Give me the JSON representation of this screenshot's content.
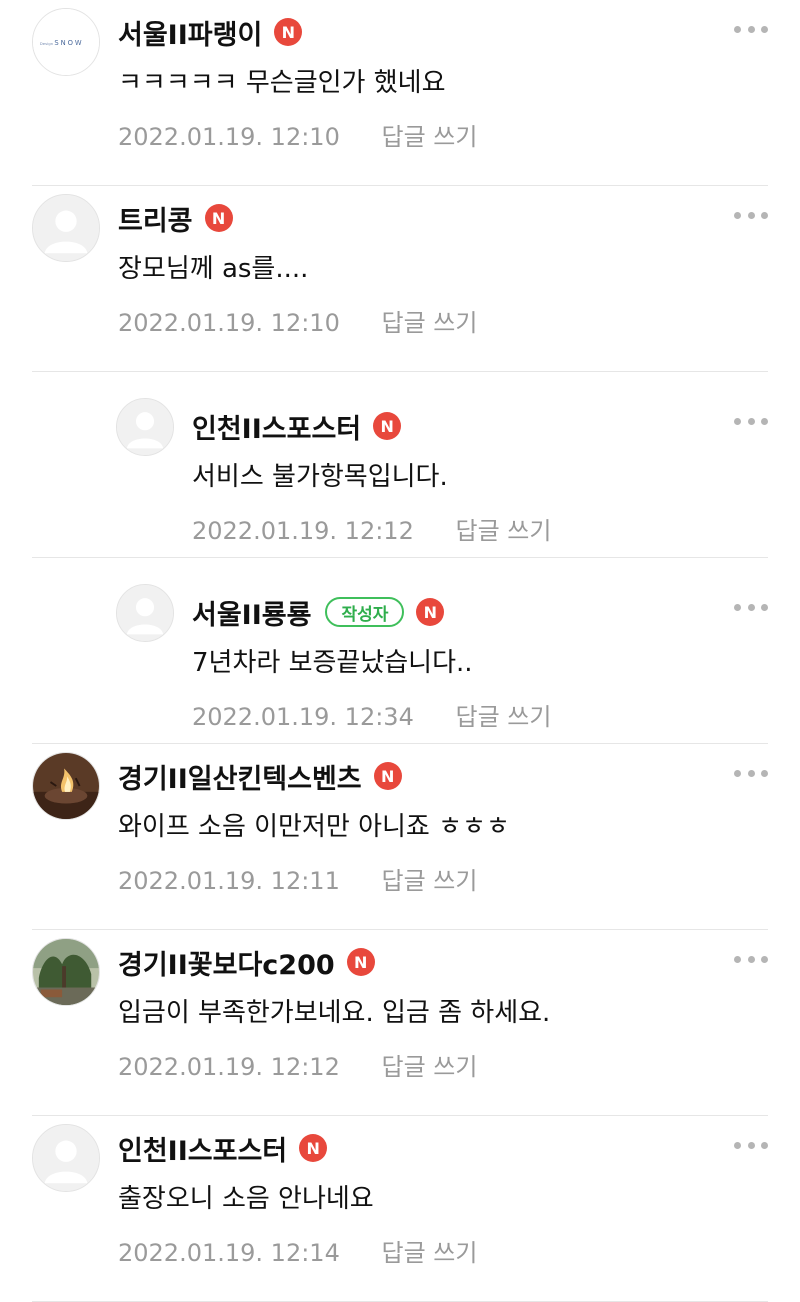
{
  "comments": [
    {
      "name": "서울II파랭이",
      "badge": "N",
      "text": "ㅋㅋㅋㅋㅋ 무슨글인가 했네요",
      "time": "2022.01.19. 12:10",
      "reply_label": "답글 쓰기",
      "avatar": "snow-logo",
      "avatar_text": "SNOW",
      "author": "",
      "is_reply": false
    },
    {
      "name": "트리콩",
      "badge": "N",
      "text": "장모님께 as를....",
      "time": "2022.01.19. 12:10",
      "reply_label": "답글 쓰기",
      "avatar": "default-profile",
      "author": "",
      "is_reply": false
    },
    {
      "name": "인천II스포스터",
      "badge": "N",
      "text": "서비스 불가항목입니다.",
      "time": "2022.01.19. 12:12",
      "reply_label": "답글 쓰기",
      "avatar": "default-profile",
      "author": "",
      "is_reply": true
    },
    {
      "name": "서울II룡룡",
      "badge": "N",
      "text": "7년차라 보증끝났습니다..",
      "time": "2022.01.19. 12:34",
      "reply_label": "답글 쓰기",
      "avatar": "default-profile",
      "author": "작성자",
      "is_reply": true
    },
    {
      "name": "경기II일산킨텍스벤츠",
      "badge": "N",
      "text": "와이프 소음 이만저만 아니죠 ㅎㅎㅎ",
      "time": "2022.01.19. 12:11",
      "reply_label": "답글 쓰기",
      "avatar": "fire-photo",
      "author": "",
      "is_reply": false
    },
    {
      "name": "경기II꽃보다c200",
      "badge": "N",
      "text": "입금이 부족한가보네요. 입금 좀 하세요.",
      "time": "2022.01.19. 12:12",
      "reply_label": "답글 쓰기",
      "avatar": "tree-photo",
      "author": "",
      "is_reply": false
    },
    {
      "name": "인천II스포스터",
      "badge": "N",
      "text": "출장오니 소음 안나네요",
      "time": "2022.01.19. 12:14",
      "reply_label": "답글 쓰기",
      "avatar": "default-profile",
      "author": "",
      "is_reply": false
    }
  ],
  "colors": {
    "n_badge": "#e8483c",
    "author_badge": "#3fbf5b",
    "meta": "#9a9a9a",
    "divider": "#e6e6e6"
  }
}
